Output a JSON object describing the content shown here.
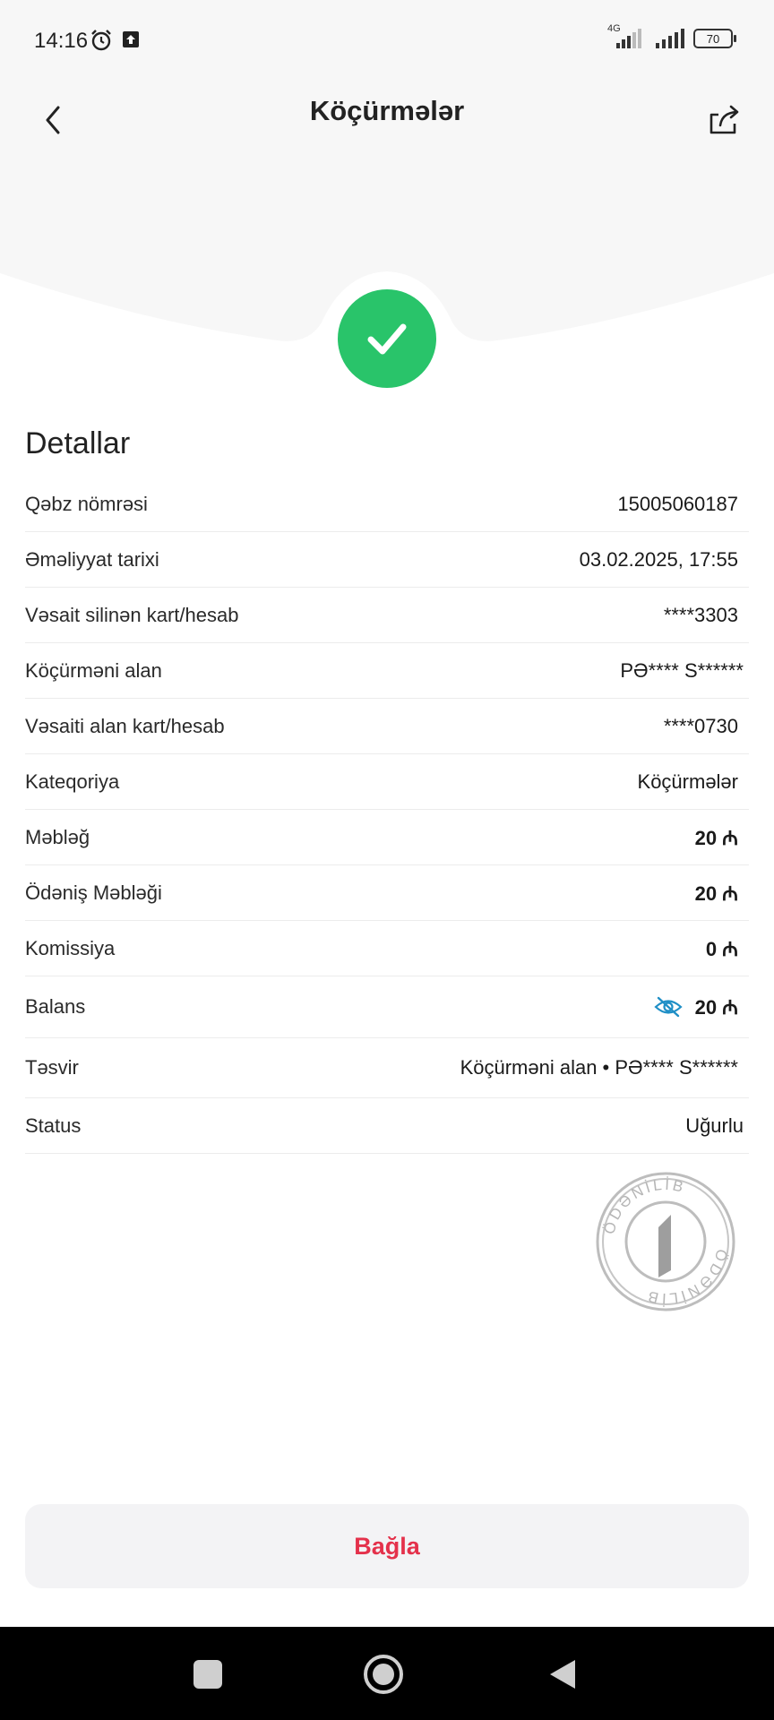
{
  "status_bar": {
    "time": "14:16",
    "network": "4G",
    "battery": "70"
  },
  "header": {
    "title": "Köçürmələr"
  },
  "details": {
    "title": "Detallar",
    "rows": [
      {
        "label": "Qəbz nömrəsi",
        "value": "15005060187"
      },
      {
        "label": "Əməliyyat tarixi",
        "value": "03.02.2025, 17:55"
      },
      {
        "label": "Vəsait silinən kart/hesab",
        "value": "****3303"
      },
      {
        "label": "Köçürməni alan",
        "value": "PƏ**** S******"
      },
      {
        "label": "Vəsaiti alan kart/hesab",
        "value": "****0730"
      },
      {
        "label": "Kateqoriya",
        "value": "Köçürmələr"
      },
      {
        "label": "Məbləğ",
        "value": "20 ₼"
      },
      {
        "label": "Ödəniş Məbləği",
        "value": "20 ₼"
      },
      {
        "label": "Komissiya",
        "value": "0 ₼"
      }
    ],
    "balance": {
      "label": "Balans",
      "value": "20 ₼"
    },
    "description": {
      "label": "Təsvir",
      "value": "Köçürməni alan • PƏ**** S******"
    },
    "status": {
      "label": "Status",
      "value": "Uğurlu"
    }
  },
  "stamp": {
    "text": "ÖDƏNİLİB"
  },
  "actions": {
    "close_label": "Bağla"
  },
  "colors": {
    "success": "#29c46a",
    "accent_red": "#e4314b",
    "accent_blue": "#1f8fc6",
    "header_bg": "#f7f7f7"
  }
}
